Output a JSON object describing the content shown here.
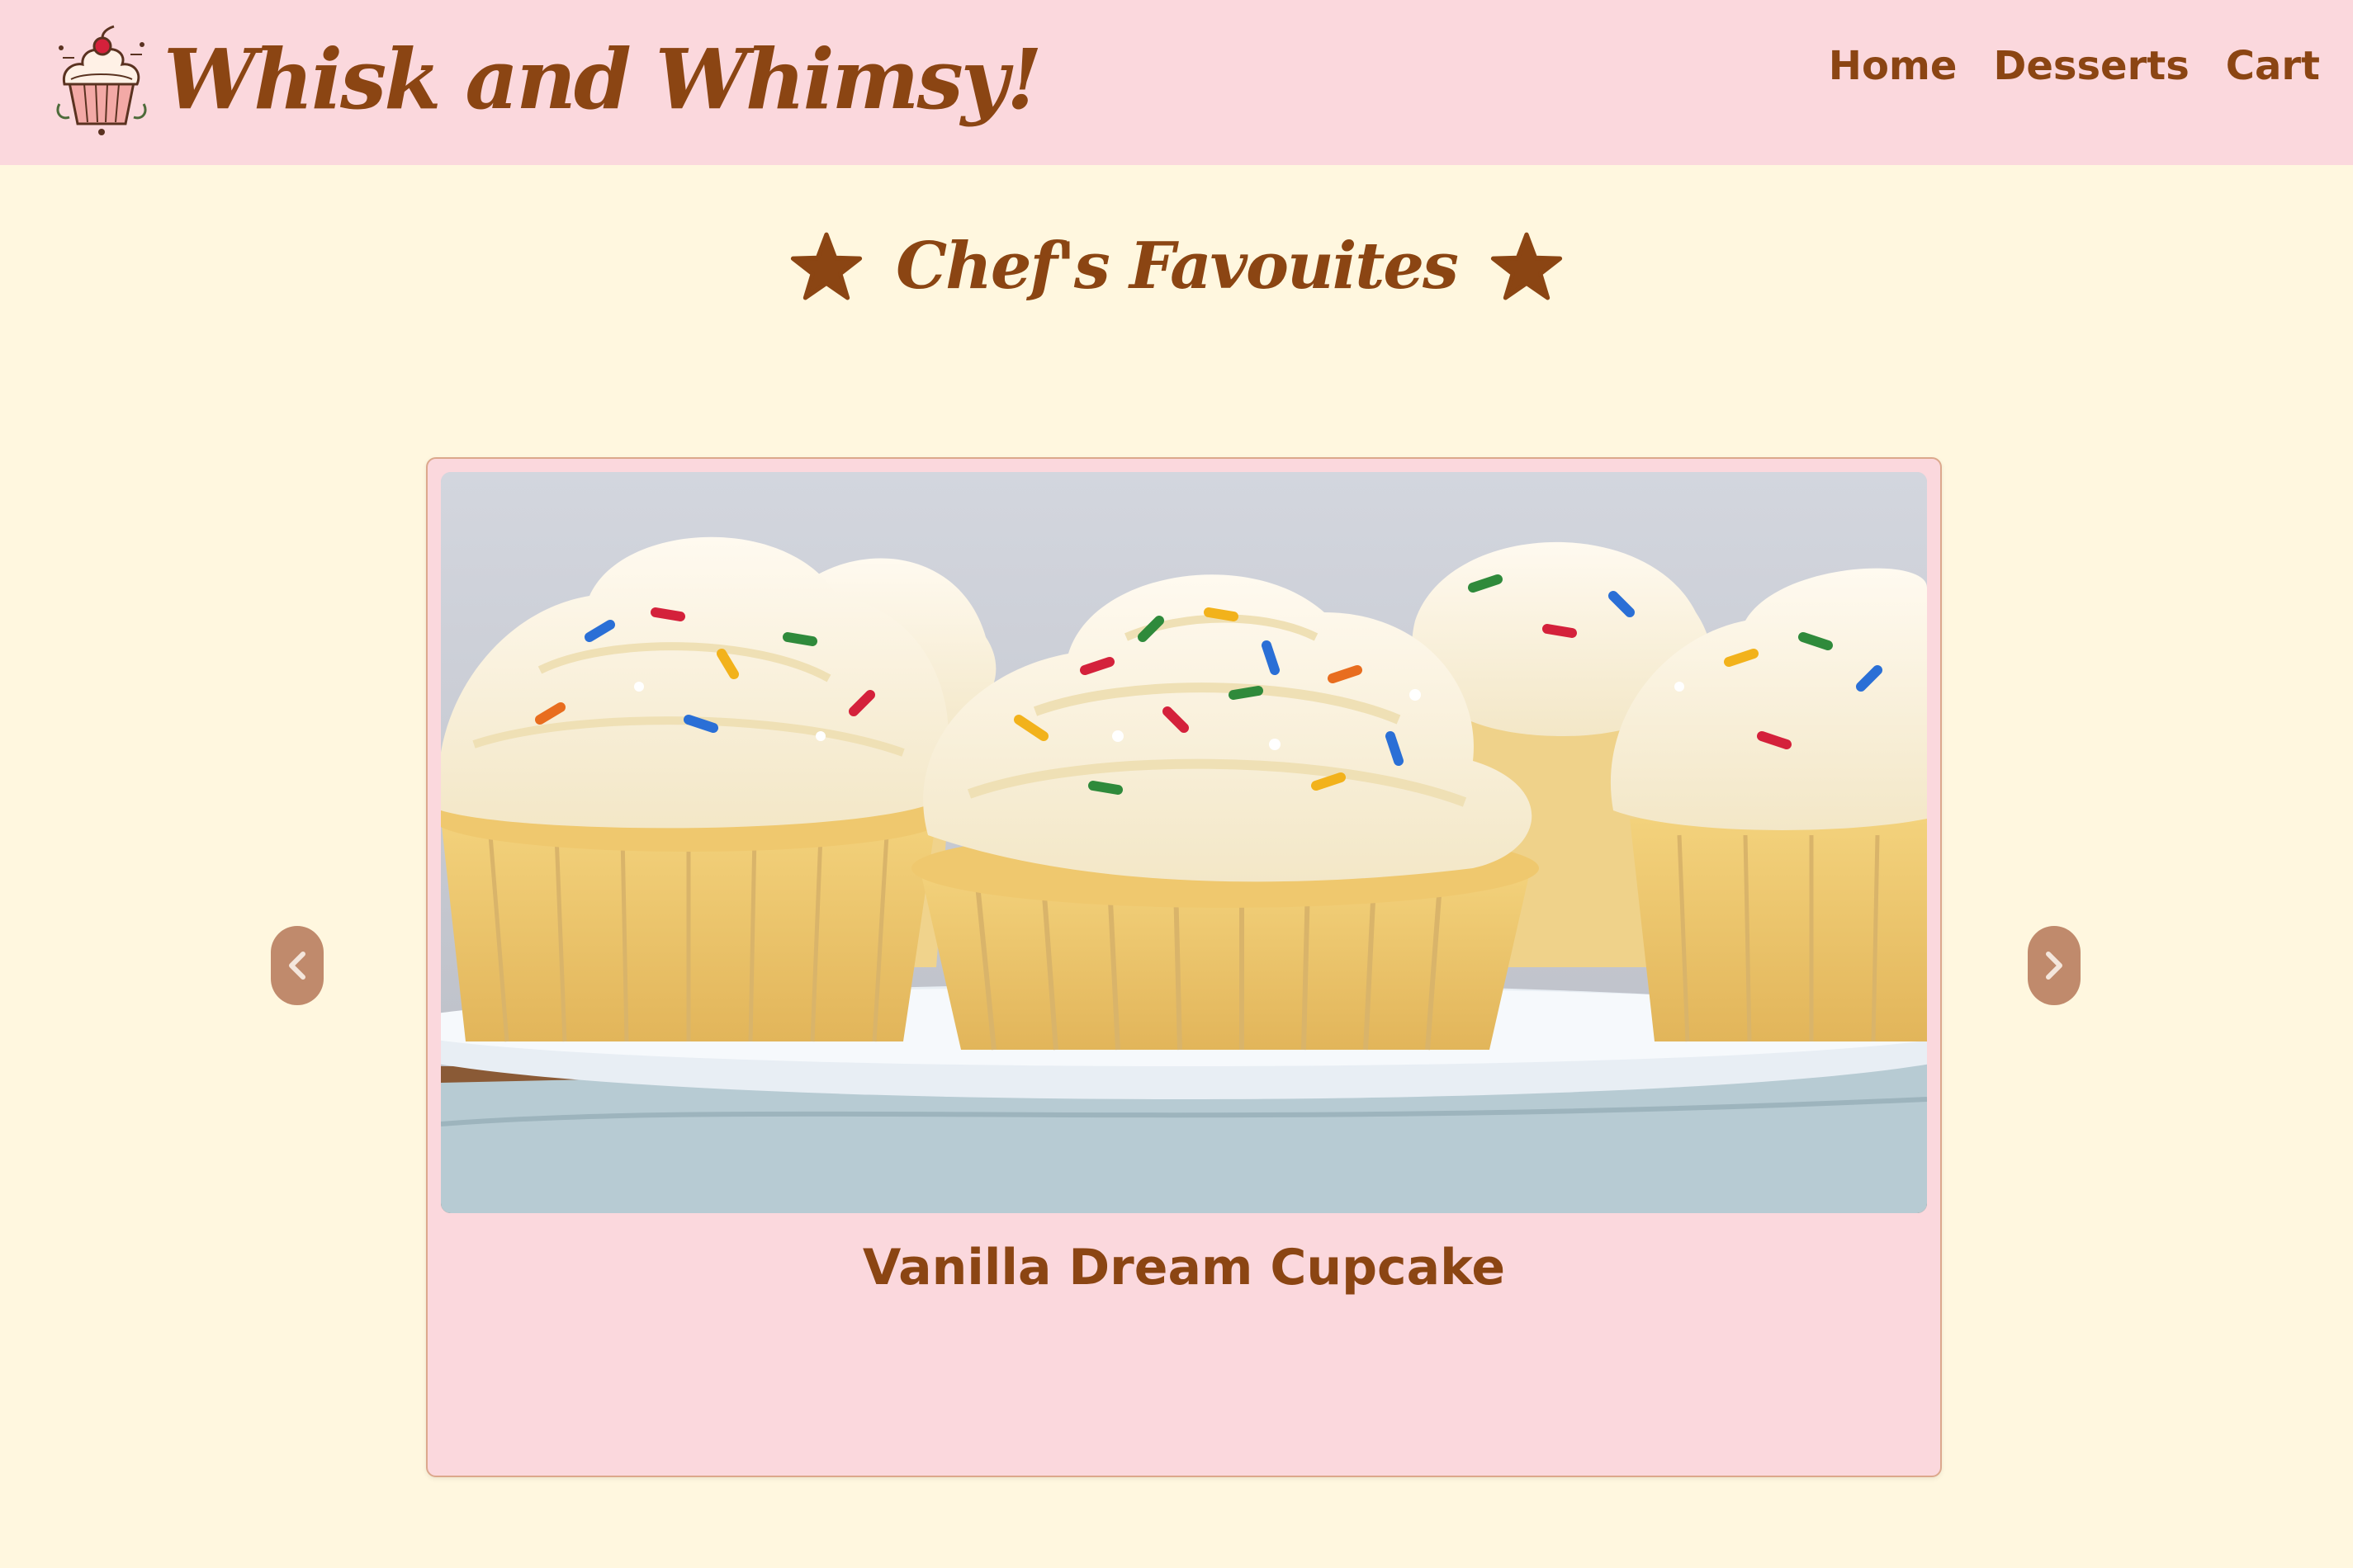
{
  "header": {
    "brand": "Whisk and Whimsy!",
    "logo_icon": "cupcake-logo-icon",
    "nav": [
      {
        "label": "Home"
      },
      {
        "label": "Desserts"
      },
      {
        "label": "Cart"
      }
    ]
  },
  "section": {
    "title": "Chef's Favouites",
    "icon": "star-icon"
  },
  "carousel": {
    "prev_icon": "chevron-left-icon",
    "next_icon": "chevron-right-icon",
    "prev_glyph": "‹",
    "next_glyph": "›",
    "current_item": {
      "title": "Vanilla Dream Cupcake",
      "image": "vanilla-cupcake-photo"
    }
  },
  "colors": {
    "header_bg": "#fbd8dd",
    "page_bg": "#fff7df",
    "accent_brown": "#8b4513",
    "arrow_bg": "#c08a6c",
    "card_border": "#dca88c"
  }
}
